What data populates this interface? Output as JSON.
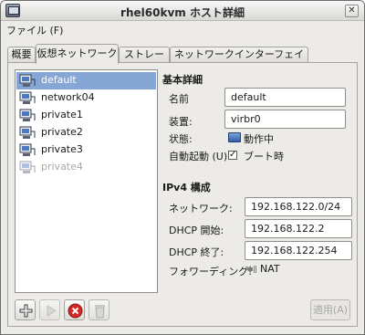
{
  "window": {
    "title": "rhel60kvm ホスト詳細",
    "close_glyph": "✕"
  },
  "menu": {
    "file": "ファイル (F)"
  },
  "tabs": [
    "概要",
    "仮想ネットワーク",
    "ストレージ",
    "ネットワークインターフェイス"
  ],
  "networks": [
    {
      "name": "default",
      "selected": true
    },
    {
      "name": "network04"
    },
    {
      "name": "private1"
    },
    {
      "name": "private2"
    },
    {
      "name": "private3"
    },
    {
      "name": "private4",
      "disabled": true
    }
  ],
  "basic": {
    "title": "基本詳細",
    "name_label": "名前",
    "name_value": "default",
    "device_label": "装置:",
    "device_value": "virbr0",
    "state_label": "状態:",
    "state_value": "動作中",
    "autostart_label": "自動起動 (U):",
    "autostart_value": "ブート時",
    "autostart_checked": true
  },
  "ipv4": {
    "title": "IPv4 構成",
    "network_label": "ネットワーク:",
    "network_value": "192.168.122.0/24",
    "dhcp_start_label": "DHCP 開始:",
    "dhcp_start_value": "192.168.122.2",
    "dhcp_end_label": "DHCP 終了:",
    "dhcp_end_value": "192.168.122.254",
    "forwarding_label": "フォワーディング:",
    "forwarding_value": "NAT"
  },
  "buttons": {
    "apply": "適用(A)"
  }
}
